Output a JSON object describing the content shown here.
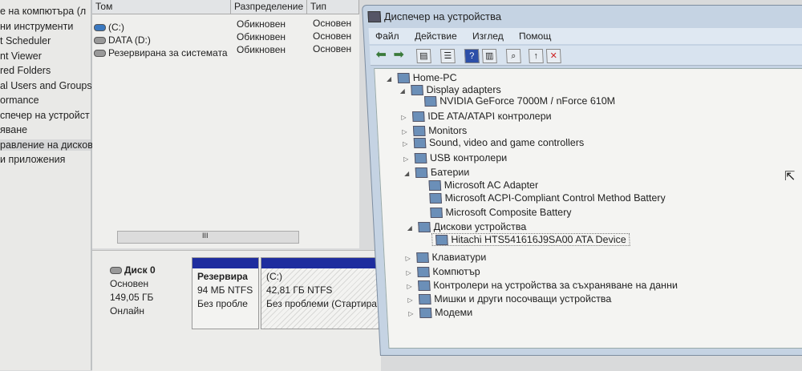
{
  "nav": {
    "items": [
      "е на компютъра (л",
      "ни инструменти",
      "t Scheduler",
      "nt Viewer",
      "red Folders",
      "al Users and Groups",
      "ormance",
      "спечер на устройст",
      "яване",
      "равление на дисков",
      "и приложения"
    ],
    "selected": 9
  },
  "volumes": {
    "headers": [
      "Том",
      "Разпределение",
      "Тип"
    ],
    "rows": [
      {
        "name": "(C:)",
        "layout": "Обикновен",
        "type": "Основен"
      },
      {
        "name": "DATA (D:)",
        "layout": "Обикновен",
        "type": "Основен"
      },
      {
        "name": "Резервирана за системата",
        "layout": "Обикновен",
        "type": "Основен"
      }
    ],
    "scroll_grip": "III"
  },
  "disk": {
    "name": "Диск 0",
    "type": "Основен",
    "size": "149,05 ГБ",
    "status": "Онлайн",
    "partitions": [
      {
        "name": "Резервира",
        "size": "94 МБ NTFS",
        "status": "Без пробле"
      },
      {
        "name": "(C:)",
        "size": "42,81 ГБ NTFS",
        "status": "Без проблеми (Стартира"
      }
    ]
  },
  "devmgr": {
    "title": "Диспечер на устройства",
    "menu": [
      "Файл",
      "Действие",
      "Изглед",
      "Помощ"
    ],
    "tree": [
      {
        "label": "Home-PC",
        "level": 0,
        "exp": "open"
      },
      {
        "label": "Display adapters",
        "level": 1,
        "exp": "open"
      },
      {
        "label": "NVIDIA GeForce 7000M / nForce 610M",
        "level": 2
      },
      {
        "label": "IDE ATA/ATAPI контролери",
        "level": 1,
        "exp": "closed"
      },
      {
        "label": "Monitors",
        "level": 1,
        "exp": "closed"
      },
      {
        "label": "Sound, video and game controllers",
        "level": 1,
        "exp": "closed"
      },
      {
        "label": "USB контролери",
        "level": 1,
        "exp": "closed"
      },
      {
        "label": "Батерии",
        "level": 1,
        "exp": "open"
      },
      {
        "label": "Microsoft AC Adapter",
        "level": 2
      },
      {
        "label": "Microsoft ACPI-Compliant Control Method Battery",
        "level": 2
      },
      {
        "label": "Microsoft Composite Battery",
        "level": 2
      },
      {
        "label": "Дискови устройства",
        "level": 1,
        "exp": "open"
      },
      {
        "label": "Hitachi HTS541616J9SA00 ATA Device",
        "level": 2,
        "selected": true
      },
      {
        "label": "Клавиатури",
        "level": 1,
        "exp": "closed"
      },
      {
        "label": "Компютър",
        "level": 1,
        "exp": "closed"
      },
      {
        "label": "Контролери на устройства за съхраняване на данни",
        "level": 1,
        "exp": "closed"
      },
      {
        "label": "Мишки и други посочващи устройства",
        "level": 1,
        "exp": "closed"
      },
      {
        "label": "Модеми",
        "level": 1,
        "exp": "closed"
      }
    ]
  }
}
